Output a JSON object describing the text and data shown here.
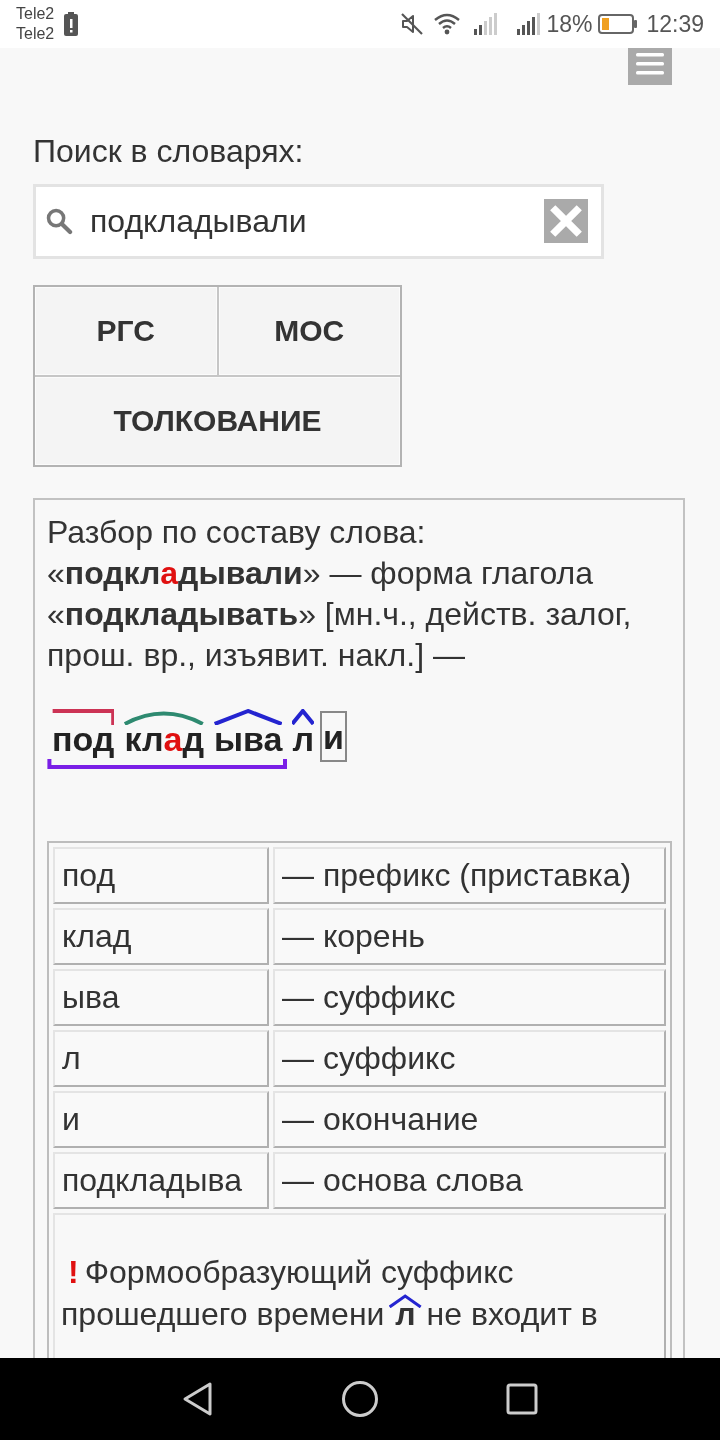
{
  "status_bar": {
    "carriers": [
      "Tele2",
      "Tele2"
    ],
    "battery": "18%",
    "time": "12:39"
  },
  "search": {
    "label": "Поиск в словарях:",
    "value": "подкладывали"
  },
  "dictionary_buttons": [
    {
      "label": "РГС"
    },
    {
      "label": "МОС"
    },
    {
      "label": "ТОЛКОВАНИЕ"
    }
  ],
  "analysis": {
    "title": "Разбор по составу слова:",
    "description": [
      {
        "kind": "plain",
        "text": "«"
      },
      {
        "kind": "bold",
        "text": "подкл"
      },
      {
        "kind": "stress",
        "text": "а"
      },
      {
        "kind": "bold",
        "text": "дывали"
      },
      {
        "kind": "plain",
        "text": "» — форма глагола «"
      },
      {
        "kind": "bold",
        "text": "подкладывать"
      },
      {
        "kind": "plain",
        "text": "» [мн.ч., действ. залог, прош. вр., изъявит. накл.] —"
      }
    ],
    "morphemes": [
      {
        "kind": "prefix",
        "in_stem": true,
        "letters": [
          {
            "text": "под",
            "stressed": false
          }
        ]
      },
      {
        "kind": "root",
        "in_stem": true,
        "letters": [
          {
            "text": "кл",
            "stressed": false
          },
          {
            "text": "а",
            "stressed": true
          },
          {
            "text": "д",
            "stressed": false
          }
        ]
      },
      {
        "kind": "suffix",
        "in_stem": true,
        "letters": [
          {
            "text": "ыва",
            "stressed": false
          }
        ]
      },
      {
        "kind": "suffix",
        "in_stem": false,
        "letters": [
          {
            "text": "л",
            "stressed": false
          }
        ]
      },
      {
        "kind": "ending",
        "in_stem": false,
        "letters": [
          {
            "text": "и",
            "stressed": false
          }
        ]
      }
    ],
    "table": {
      "rows": [
        {
          "morpheme": "под",
          "role": "— префикс (приставка)"
        },
        {
          "morpheme": "клад",
          "role": "— корень"
        },
        {
          "morpheme": "ыва",
          "role": "— суффикс"
        },
        {
          "morpheme": "л",
          "role": "— суффикс"
        },
        {
          "morpheme": "и",
          "role": "— окончание"
        },
        {
          "morpheme": "подкладыва",
          "role": "— основа слова"
        }
      ]
    },
    "note": [
      {
        "kind": "alert",
        "text": "!"
      },
      {
        "kind": "plain",
        "text": "Формообразующий суффикс прошедшего времени "
      },
      {
        "kind": "suffix",
        "text": "л"
      },
      {
        "kind": "plain",
        "text": " не входит в"
      }
    ]
  }
}
